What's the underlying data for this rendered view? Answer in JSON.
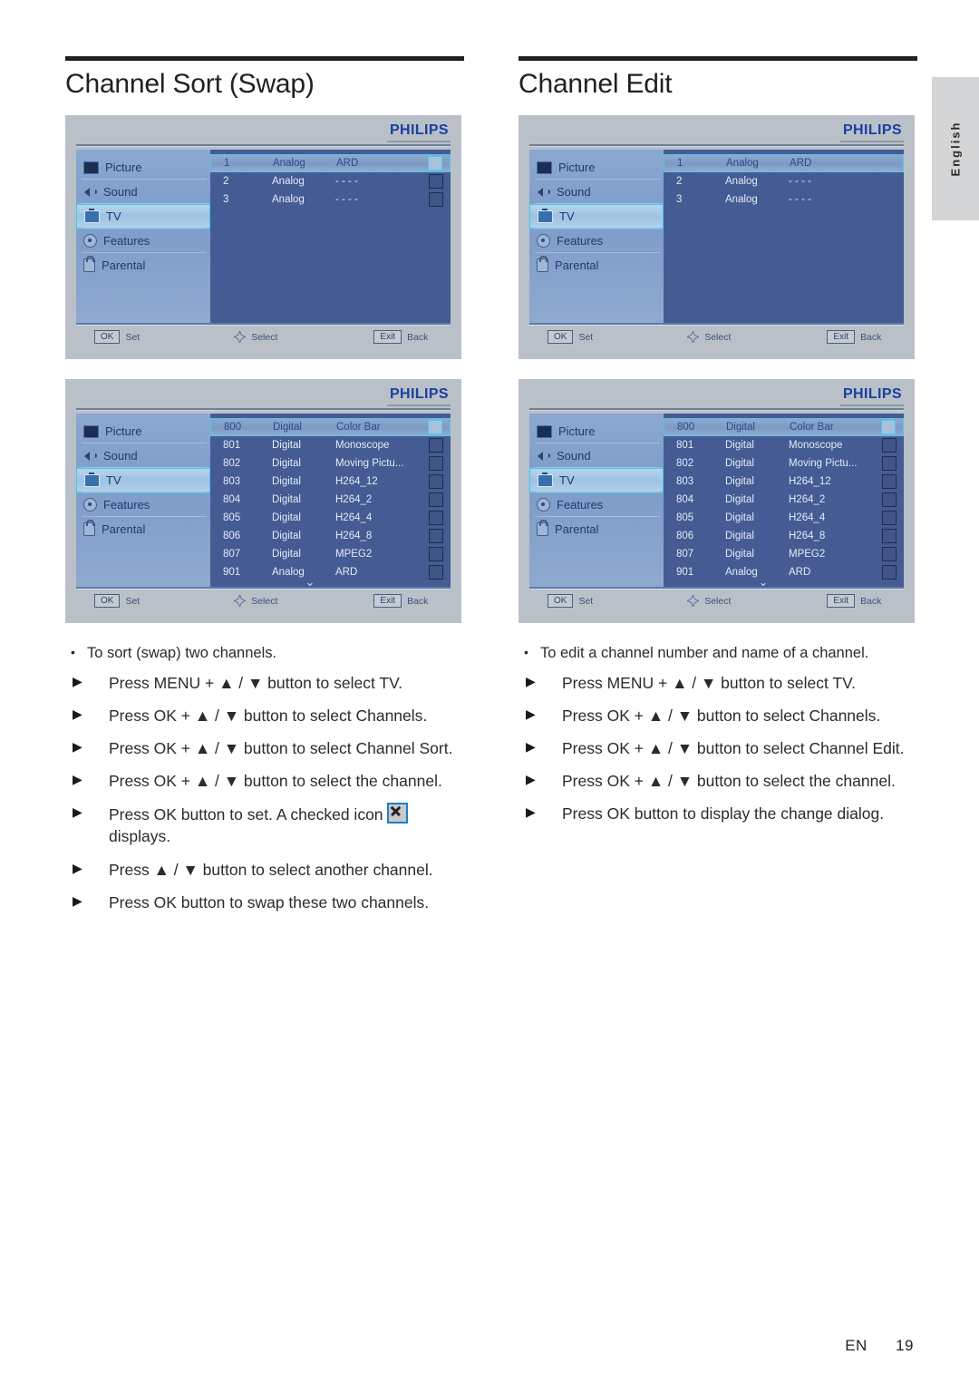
{
  "page": {
    "language_tab": "English",
    "footer_code": "EN",
    "footer_number": "19"
  },
  "columns": [
    {
      "title": "Channel Sort (Swap)",
      "screens": [
        {
          "brand": "PHILIPS",
          "sidebar": [
            {
              "label": "Picture",
              "icon": "picture-icon",
              "active": false
            },
            {
              "label": "Sound",
              "icon": "speaker-icon",
              "active": false
            },
            {
              "label": "TV",
              "icon": "tv-icon",
              "active": true
            },
            {
              "label": "Features",
              "icon": "gear-icon",
              "active": false
            },
            {
              "label": "Parental",
              "icon": "lock-icon",
              "active": false
            }
          ],
          "channels": [
            {
              "number": "1",
              "type": "Analog",
              "name": "ARD",
              "selected": true,
              "checkbox": true
            },
            {
              "number": "2",
              "type": "Analog",
              "name": "- - - -",
              "selected": false,
              "checkbox": true
            },
            {
              "number": "3",
              "type": "Analog",
              "name": "- - - -",
              "selected": false,
              "checkbox": true
            }
          ],
          "show_checkboxes": true,
          "show_scroll_chevron": false,
          "footer": [
            {
              "key": "OK",
              "label": "Set"
            },
            {
              "key": "",
              "label": "Select",
              "icon": "dpad-icon"
            },
            {
              "key": "Exit",
              "label": "Back"
            }
          ]
        },
        {
          "brand": "PHILIPS",
          "sidebar": [
            {
              "label": "Picture",
              "icon": "picture-icon",
              "active": false
            },
            {
              "label": "Sound",
              "icon": "speaker-icon",
              "active": false
            },
            {
              "label": "TV",
              "icon": "tv-icon",
              "active": true
            },
            {
              "label": "Features",
              "icon": "gear-icon",
              "active": false
            },
            {
              "label": "Parental",
              "icon": "lock-icon",
              "active": false
            }
          ],
          "channels": [
            {
              "number": "800",
              "type": "Digital",
              "name": "Color Bar",
              "selected": true,
              "checkbox": true
            },
            {
              "number": "801",
              "type": "Digital",
              "name": "Monoscope",
              "selected": false,
              "checkbox": true
            },
            {
              "number": "802",
              "type": "Digital",
              "name": "Moving Pictu...",
              "selected": false,
              "checkbox": true
            },
            {
              "number": "803",
              "type": "Digital",
              "name": "H264_12",
              "selected": false,
              "checkbox": true
            },
            {
              "number": "804",
              "type": "Digital",
              "name": "H264_2",
              "selected": false,
              "checkbox": true
            },
            {
              "number": "805",
              "type": "Digital",
              "name": "H264_4",
              "selected": false,
              "checkbox": true
            },
            {
              "number": "806",
              "type": "Digital",
              "name": "H264_8",
              "selected": false,
              "checkbox": true
            },
            {
              "number": "807",
              "type": "Digital",
              "name": "MPEG2",
              "selected": false,
              "checkbox": true
            },
            {
              "number": "901",
              "type": "Analog",
              "name": "ARD",
              "selected": false,
              "checkbox": true
            }
          ],
          "show_checkboxes": true,
          "show_scroll_chevron": true,
          "footer": [
            {
              "key": "OK",
              "label": "Set"
            },
            {
              "key": "",
              "label": "Select",
              "icon": "dpad-icon"
            },
            {
              "key": "Exit",
              "label": "Back"
            }
          ]
        }
      ],
      "bullet": "To sort (swap) two channels.",
      "steps": [
        {
          "text": "Press MENU + ▲ / ▼ button to select TV."
        },
        {
          "text": "Press OK + ▲ / ▼ button to select Channels."
        },
        {
          "text": "Press OK + ▲ / ▼ button to select Channel Sort."
        },
        {
          "text": "Press OK + ▲ / ▼ button to select the channel."
        },
        {
          "text_before": "Press OK button to set. A checked icon ",
          "icon": "checked-x-icon",
          "text_after": " displays."
        },
        {
          "text": "Press ▲ / ▼ button to select another channel."
        },
        {
          "text": "Press OK button to swap these two channels."
        }
      ]
    },
    {
      "title": "Channel Edit",
      "screens": [
        {
          "brand": "PHILIPS",
          "sidebar": [
            {
              "label": "Picture",
              "icon": "picture-icon",
              "active": false
            },
            {
              "label": "Sound",
              "icon": "speaker-icon",
              "active": false
            },
            {
              "label": "TV",
              "icon": "tv-icon",
              "active": true
            },
            {
              "label": "Features",
              "icon": "gear-icon",
              "active": false
            },
            {
              "label": "Parental",
              "icon": "lock-icon",
              "active": false
            }
          ],
          "channels": [
            {
              "number": "1",
              "type": "Analog",
              "name": "ARD",
              "selected": true,
              "checkbox": false
            },
            {
              "number": "2",
              "type": "Analog",
              "name": "- - - -",
              "selected": false,
              "checkbox": false
            },
            {
              "number": "3",
              "type": "Analog",
              "name": "- - - -",
              "selected": false,
              "checkbox": false
            }
          ],
          "show_checkboxes": false,
          "show_scroll_chevron": false,
          "footer": [
            {
              "key": "OK",
              "label": "Set"
            },
            {
              "key": "",
              "label": "Select",
              "icon": "dpad-icon"
            },
            {
              "key": "Exit",
              "label": "Back"
            }
          ]
        },
        {
          "brand": "PHILIPS",
          "sidebar": [
            {
              "label": "Picture",
              "icon": "picture-icon",
              "active": false
            },
            {
              "label": "Sound",
              "icon": "speaker-icon",
              "active": false
            },
            {
              "label": "TV",
              "icon": "tv-icon",
              "active": true
            },
            {
              "label": "Features",
              "icon": "gear-icon",
              "active": false
            },
            {
              "label": "Parental",
              "icon": "lock-icon",
              "active": false
            }
          ],
          "channels": [
            {
              "number": "800",
              "type": "Digital",
              "name": "Color Bar",
              "selected": true,
              "checkbox": true
            },
            {
              "number": "801",
              "type": "Digital",
              "name": "Monoscope",
              "selected": false,
              "checkbox": true
            },
            {
              "number": "802",
              "type": "Digital",
              "name": "Moving Pictu...",
              "selected": false,
              "checkbox": true
            },
            {
              "number": "803",
              "type": "Digital",
              "name": "H264_12",
              "selected": false,
              "checkbox": true
            },
            {
              "number": "804",
              "type": "Digital",
              "name": "H264_2",
              "selected": false,
              "checkbox": true
            },
            {
              "number": "805",
              "type": "Digital",
              "name": "H264_4",
              "selected": false,
              "checkbox": true
            },
            {
              "number": "806",
              "type": "Digital",
              "name": "H264_8",
              "selected": false,
              "checkbox": true
            },
            {
              "number": "807",
              "type": "Digital",
              "name": "MPEG2",
              "selected": false,
              "checkbox": true
            },
            {
              "number": "901",
              "type": "Analog",
              "name": "ARD",
              "selected": false,
              "checkbox": true
            }
          ],
          "show_checkboxes": true,
          "show_scroll_chevron": true,
          "footer": [
            {
              "key": "OK",
              "label": "Set"
            },
            {
              "key": "",
              "label": "Select",
              "icon": "dpad-icon"
            },
            {
              "key": "Exit",
              "label": "Back"
            }
          ]
        }
      ],
      "bullet": "To edit a channel number and name of a channel.",
      "steps": [
        {
          "text": "Press MENU + ▲ / ▼ button to select TV."
        },
        {
          "text": "Press OK + ▲ / ▼ button to select Channels."
        },
        {
          "text": "Press OK + ▲ / ▼ button to select Channel Edit."
        },
        {
          "text": "Press OK + ▲ / ▼ button to select the channel."
        },
        {
          "text": "Press OK button to display the change dialog."
        }
      ]
    }
  ]
}
